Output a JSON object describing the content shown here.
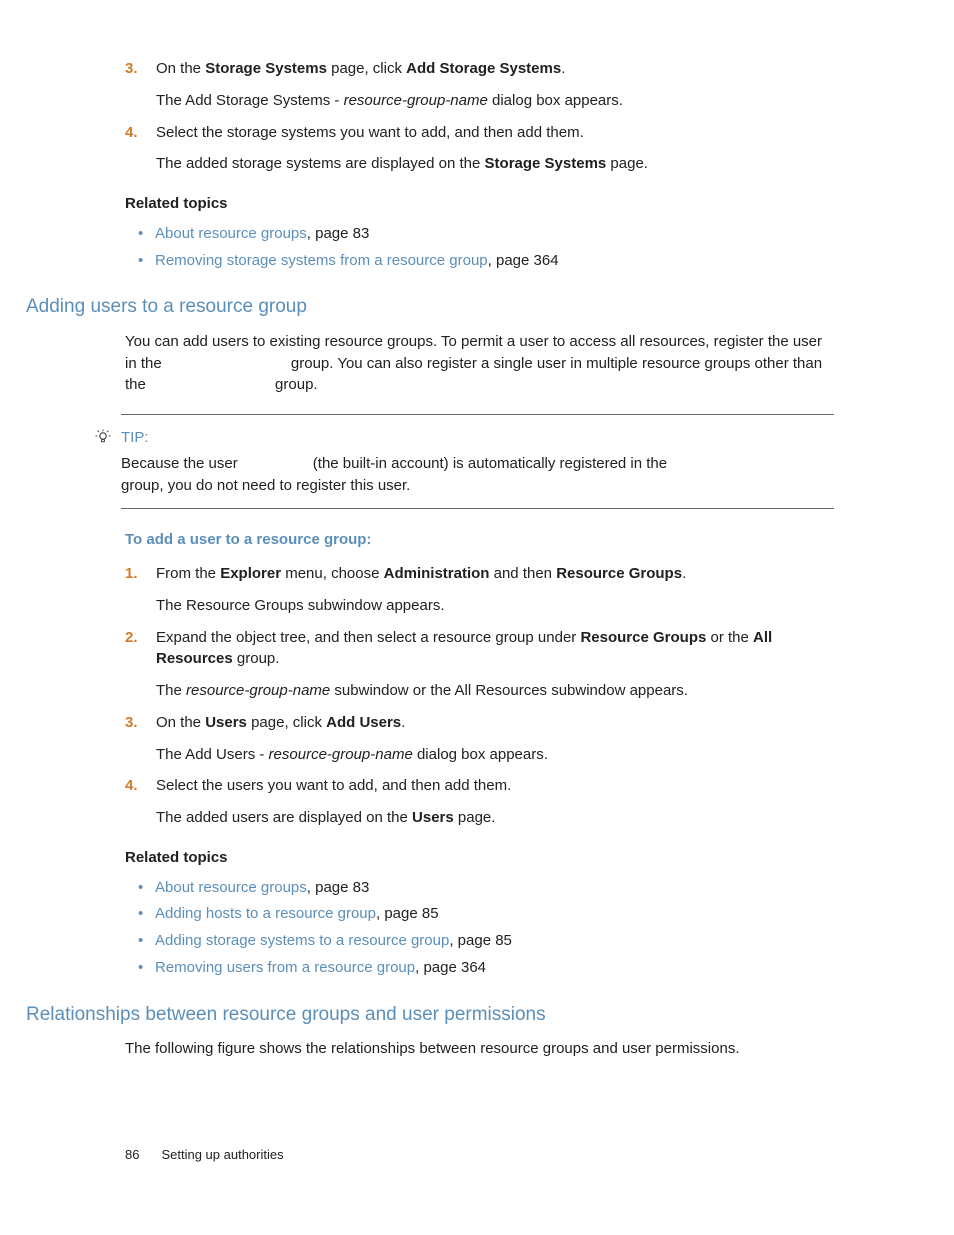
{
  "steps_top": [
    {
      "num": "3.",
      "line1_pre": "On the ",
      "line1_b1": "Storage Systems",
      "line1_mid": " page, click ",
      "line1_b2": "Add Storage Systems",
      "line1_post": ".",
      "line2_pre": "The Add Storage Systems - ",
      "line2_em": "resource-group-name",
      "line2_post": " dialog box appears."
    },
    {
      "num": "4.",
      "line1": "Select the storage systems you want to add, and then add them.",
      "line2_pre": "The added storage systems are displayed on the ",
      "line2_b": "Storage Systems",
      "line2_post": " page."
    }
  ],
  "related1_heading": "Related topics",
  "related1": [
    {
      "link": "About resource groups",
      "rest": ", page 83"
    },
    {
      "link": "Removing storage systems from a resource group",
      "rest": ", page 364"
    }
  ],
  "section1_title": "Adding users to a resource group",
  "section1_body_a": "You can add users to existing resource groups. To permit a user to access all resources, register the user in the ",
  "section1_body_b": " group. You can also register a single user in multiple resource groups other than the ",
  "section1_body_c": " group.",
  "tip_label": "TIP:",
  "tip_a": "Because the user ",
  "tip_b": " (the built-in account) is automatically registered in the ",
  "tip_c": " group, you do not need to register this user.",
  "proc_heading": "To add a user to a resource group:",
  "steps_users": [
    {
      "num": "1.",
      "pre": "From the ",
      "b1": "Explorer",
      "mid1": " menu, choose ",
      "b2": "Administration",
      "mid2": " and then ",
      "b3": "Resource Groups",
      "post": ".",
      "line2": "The Resource Groups subwindow appears."
    },
    {
      "num": "2.",
      "pre": "Expand the object tree, and then select a resource group under ",
      "b1": "Resource Groups",
      "mid1": " or the ",
      "b2": "All Resources",
      "post": " group.",
      "line2_pre": "The ",
      "line2_em": "resource-group-name",
      "line2_post": " subwindow or the All Resources subwindow appears."
    },
    {
      "num": "3.",
      "pre": "On the ",
      "b1": "Users",
      "mid1": " page, click ",
      "b2": "Add Users",
      "post": ".",
      "line2_pre": "The Add Users - ",
      "line2_em": "resource-group-name",
      "line2_post": " dialog box appears."
    },
    {
      "num": "4.",
      "line1": "Select the users you want to add, and then add them.",
      "line2_pre": "The added users are displayed on the ",
      "line2_b": "Users",
      "line2_post": " page."
    }
  ],
  "related2_heading": "Related topics",
  "related2": [
    {
      "link": "About resource groups",
      "rest": ", page 83"
    },
    {
      "link": "Adding hosts to a resource group",
      "rest": ", page 85"
    },
    {
      "link": "Adding storage systems to a resource group",
      "rest": ", page 85"
    },
    {
      "link": "Removing users from a resource group",
      "rest": ", page 364"
    }
  ],
  "section2_title": "Relationships between resource groups and user permissions",
  "section2_body": "The following figure shows the relationships between resource groups and user permissions.",
  "footer_page": "86",
  "footer_section": "Setting up authorities"
}
